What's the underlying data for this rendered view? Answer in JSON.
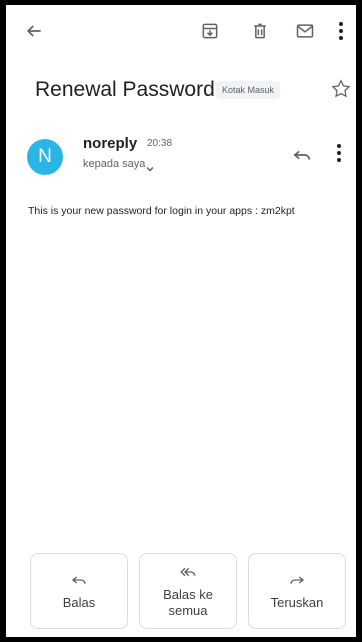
{
  "email": {
    "subject": "Renewal Password",
    "label": "Kotak Masuk",
    "sender": {
      "avatar_letter": "N",
      "name": "noreply",
      "time": "20:38",
      "recipient": "kepada saya"
    },
    "body": "This is your new password for login in your apps : zm2kpt"
  },
  "actions": {
    "reply": "Balas",
    "reply_all": "Balas ke semua",
    "forward": "Teruskan"
  },
  "colors": {
    "avatar": "#29b6e6",
    "icon": "#5f6368"
  }
}
